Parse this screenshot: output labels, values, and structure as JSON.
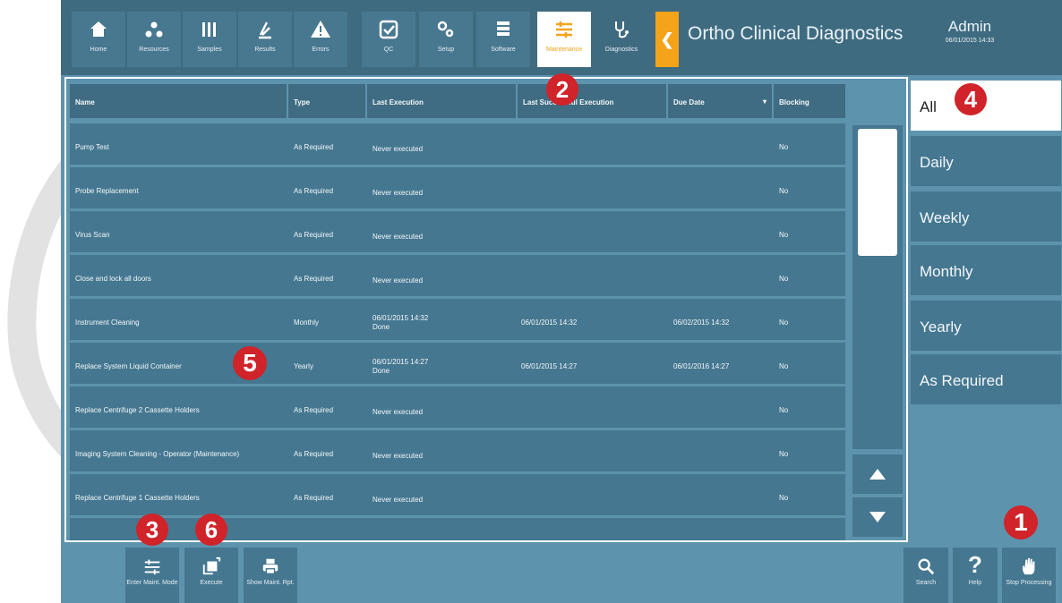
{
  "nav": [
    {
      "label": "Home",
      "icon": "home-icon"
    },
    {
      "label": "Resources",
      "icon": "resources-icon"
    },
    {
      "label": "Samples",
      "icon": "samples-icon"
    },
    {
      "label": "Results",
      "icon": "results-icon"
    },
    {
      "label": "Errors",
      "icon": "errors-icon"
    },
    {
      "label": "QC",
      "icon": "qc-icon"
    },
    {
      "label": "Setup",
      "icon": "setup-icon"
    },
    {
      "label": "Software",
      "icon": "software-icon"
    },
    {
      "label": "Maintenance",
      "icon": "maintenance-icon",
      "active": true
    },
    {
      "label": "Diagnostics",
      "icon": "diagnostics-icon"
    }
  ],
  "back_icon": "chevron-left-icon",
  "app_title": "Ortho Clinical Diagnostics",
  "user": {
    "name": "Admin",
    "datetime": "06/01/2015 14:33"
  },
  "table": {
    "columns": [
      "Name",
      "Type",
      "Last Execution",
      "Last Successful Execution",
      "Due Date",
      "Blocking"
    ],
    "sort_column": "Due Date",
    "rows": [
      {
        "name": "Pump Test",
        "type": "As Required",
        "last": "Never executed",
        "last_ok": "",
        "due": "",
        "blocking": "No"
      },
      {
        "name": "Probe Replacement",
        "type": "As Required",
        "last": "Never executed",
        "last_ok": "",
        "due": "",
        "blocking": "No"
      },
      {
        "name": "Virus Scan",
        "type": "As Required",
        "last": "Never executed",
        "last_ok": "",
        "due": "",
        "blocking": "No"
      },
      {
        "name": "Close and lock all doors",
        "type": "As Required",
        "last": "Never executed",
        "last_ok": "",
        "due": "",
        "blocking": "No"
      },
      {
        "name": "Instrument Cleaning",
        "type": "Monthly",
        "last": "06/01/2015 14:32",
        "last_status": "Done",
        "last_ok": "06/01/2015 14:32",
        "due": "06/02/2015 14:32",
        "blocking": "No"
      },
      {
        "name": "Replace System Liquid Container",
        "type": "Yearly",
        "last": "06/01/2015 14:27",
        "last_status": "Done",
        "last_ok": "06/01/2015 14:27",
        "due": "06/01/2016 14:27",
        "blocking": "No"
      },
      {
        "name": "Replace Centrifuge 2 Cassette Holders",
        "type": "As Required",
        "last": "Never executed",
        "last_ok": "",
        "due": "",
        "blocking": "No"
      },
      {
        "name": "Imaging System Cleaning - Operator (Maintenance)",
        "type": "As Required",
        "last": "Never executed",
        "last_ok": "",
        "due": "",
        "blocking": "No"
      },
      {
        "name": "Replace Centrifuge 1 Cassette Holders",
        "type": "As Required",
        "last": "Never executed",
        "last_ok": "",
        "due": "",
        "blocking": "No"
      }
    ]
  },
  "scroll": {
    "up_icon": "triangle-up-icon",
    "down_icon": "triangle-down-icon"
  },
  "filters": [
    {
      "label": "All",
      "active": true
    },
    {
      "label": "Daily"
    },
    {
      "label": "Weekly"
    },
    {
      "label": "Monthly"
    },
    {
      "label": "Yearly"
    },
    {
      "label": "As Required"
    }
  ],
  "toolbar": [
    {
      "label": "Enter Maint. Mode",
      "icon": "maintenance-mode-icon"
    },
    {
      "label": "Execute",
      "icon": "execute-icon"
    },
    {
      "label": "Show Maint. Rpt.",
      "icon": "printer-icon"
    }
  ],
  "right_tools": [
    {
      "label": "Search",
      "icon": "search-icon"
    },
    {
      "label": "Help",
      "icon": "help-icon"
    },
    {
      "label": "Stop Processing",
      "icon": "stop-hand-icon"
    }
  ],
  "callouts": [
    "1",
    "2",
    "3",
    "4",
    "5",
    "6"
  ],
  "colors": {
    "accent": "#f5a31b",
    "callout": "#d0232a",
    "panel": "#457790",
    "frame": "#5e93ad",
    "topbar": "#3f6b80"
  }
}
